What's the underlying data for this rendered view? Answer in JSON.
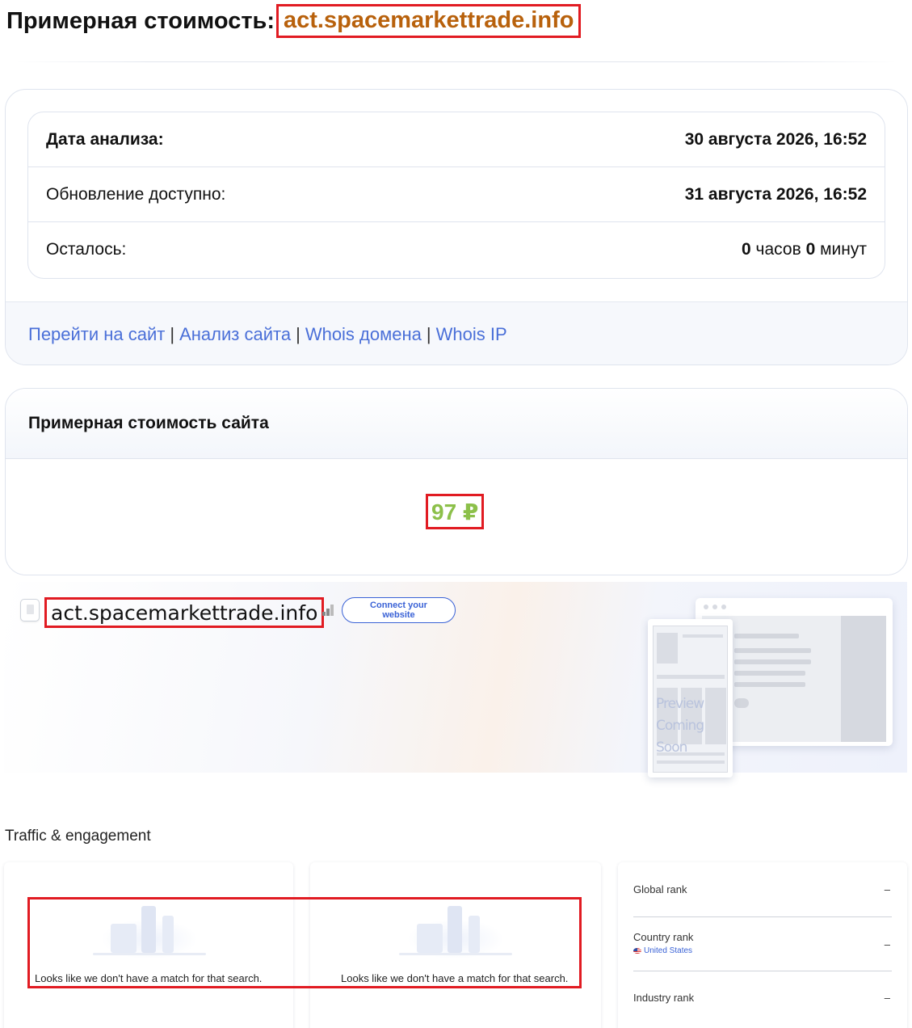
{
  "header": {
    "title_prefix": "Примерная стоимость:",
    "domain": "act.spacemarkettrade.info"
  },
  "analysis": {
    "rows": [
      {
        "label": "Дата анализа:",
        "value": "30 августа 2026, 16:52"
      },
      {
        "label": "Обновление доступно:",
        "value": "31 августа 2026, 16:52"
      }
    ],
    "remaining": {
      "label": "Осталось:",
      "hours": "0",
      "hours_unit": "часов",
      "minutes": "0",
      "minutes_unit": "минут"
    }
  },
  "links": {
    "goto_site": "Перейти на сайт",
    "site_analysis": "Анализ сайта",
    "whois_domain": "Whois домена",
    "whois_ip": "Whois IP",
    "separator": "|"
  },
  "value_card": {
    "title": "Примерная стоимость сайта",
    "price": "97 ₽"
  },
  "hero": {
    "domain": "act.spacemarkettrade.info",
    "connect_line1": "Connect your",
    "connect_line2": "website",
    "preview_line1": "Preview",
    "preview_line2": "Coming Soon"
  },
  "traffic": {
    "section_title": "Traffic & engagement",
    "empty_message": "Looks like we don't have a match for that search.",
    "ranks": [
      {
        "label": "Global rank",
        "value": "–"
      },
      {
        "label": "Country rank",
        "value": "–",
        "country": "United States"
      },
      {
        "label": "Industry rank",
        "value": "–"
      }
    ]
  }
}
